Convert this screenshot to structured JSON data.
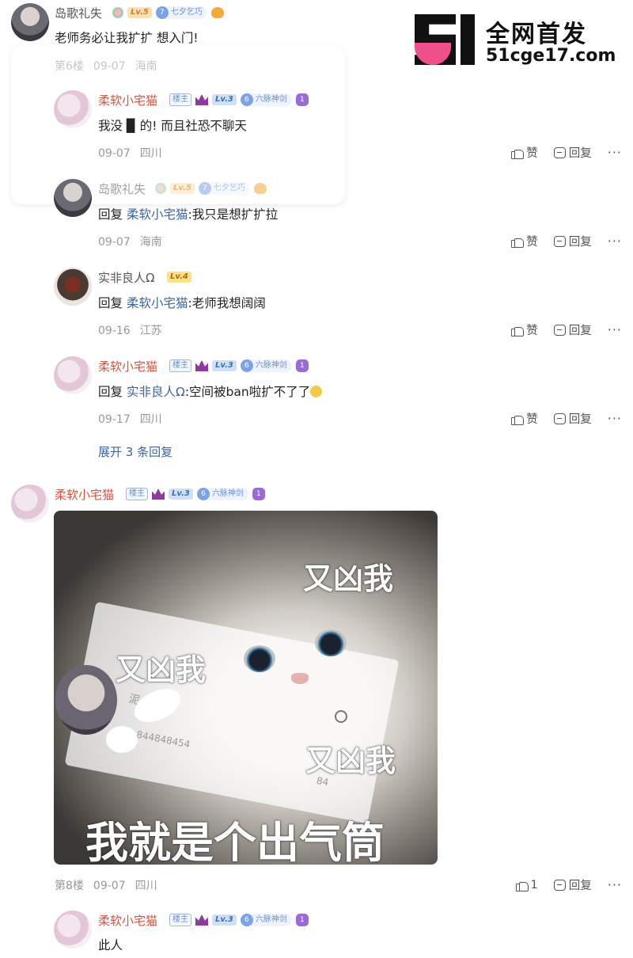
{
  "watermark": {
    "line1": "全网首发",
    "line2": "51cge17.com"
  },
  "top_comment": {
    "user": "岛歌礼失",
    "level": "Lv.5",
    "medal_num": "7",
    "medal_text": "七夕乞巧",
    "text": "老师务必让我扩扩 想入门!",
    "floor": "第6楼",
    "date": "09-07",
    "location": "海南"
  },
  "replies": [
    {
      "user": "柔软小宅猫",
      "owner_tag": "楼主",
      "level": "Lv.3",
      "medal_num": "6",
      "medal_text": "六脉神剑",
      "purple_badge": "1",
      "text": "我没 ▉ 的! 而且社恐不聊天",
      "date": "09-07",
      "location": "四川",
      "like": "赞",
      "reply": "回复"
    },
    {
      "user": "岛歌礼失",
      "level": "Lv.5",
      "medal_num": "7",
      "medal_text": "七夕乞巧",
      "reply_prefix": "回复",
      "reply_to": "柔软小宅猫",
      "text": ":我只是想扩扩拉",
      "date": "09-07",
      "location": "海南",
      "like": "赞",
      "reply": "回复"
    },
    {
      "user": "实非良人Ω",
      "level": "Lv.4",
      "reply_prefix": "回复",
      "reply_to": "柔软小宅猫",
      "text": ":老师我想阔阔",
      "date": "09-16",
      "location": "江苏",
      "like": "赞",
      "reply": "回复"
    },
    {
      "user": "柔软小宅猫",
      "owner_tag": "楼主",
      "level": "Lv.3",
      "medal_num": "6",
      "medal_text": "六脉神剑",
      "purple_badge": "1",
      "reply_prefix": "回复",
      "reply_to": "实非良人Ω",
      "text": ":空间被ban啦扩不了了",
      "date": "09-17",
      "location": "四川",
      "like": "赞",
      "reply": "回复"
    }
  ],
  "expand_label": "展开 3 条回复",
  "second_post": {
    "user": "柔软小宅猫",
    "owner_tag": "楼主",
    "level": "Lv.3",
    "medal_num": "6",
    "medal_text": "六脉神剑",
    "purple_badge": "1",
    "image_captions": {
      "top_right": "又凶我",
      "middle_left": "又凶我",
      "bottom_right": "又凶我",
      "bottom": "我就是个出气筒",
      "card_name": "泥",
      "card_id": "844848454",
      "card_count": "84"
    },
    "floor": "第8楼",
    "date": "09-07",
    "location": "四川",
    "like_count": "1",
    "reply": "回复"
  },
  "last_reply": {
    "user": "柔软小宅猫",
    "owner_tag": "楼主",
    "level": "Lv.3",
    "medal_num": "6",
    "medal_text": "六脉神剑",
    "purple_badge": "1",
    "text": "此人"
  },
  "colors": {
    "name_red": "#e0513e",
    "link_blue": "#3f64a8",
    "meta_gray": "#999999"
  }
}
